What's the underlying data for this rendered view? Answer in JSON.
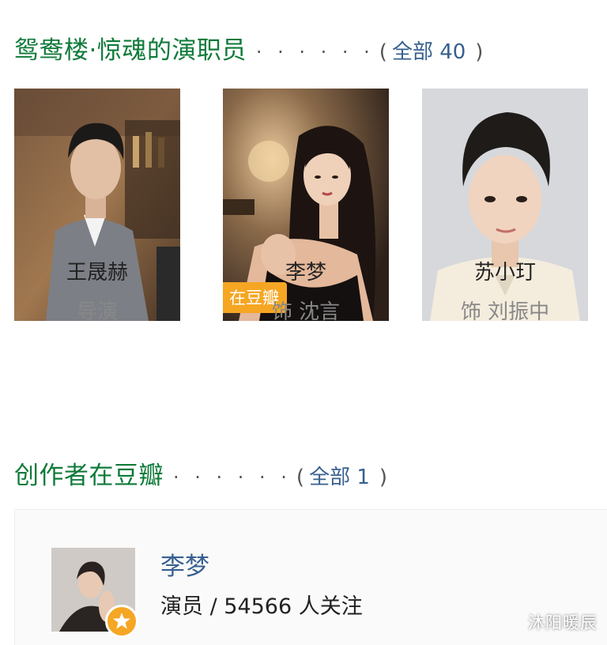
{
  "cast_section": {
    "title": "鸳鸯楼·惊魂的演职员",
    "dots": "· · · · · ·",
    "open_paren": "(",
    "all_label": "全部 40",
    "close_paren": ")"
  },
  "cast": [
    {
      "name": "王晟赫",
      "role": "导演"
    },
    {
      "name": "李梦",
      "role": "饰 沈言",
      "badge": "在豆瓣"
    },
    {
      "name": "苏小玎",
      "role": "饰 刘振中"
    }
  ],
  "creators_section": {
    "title": "创作者在豆瓣",
    "dots": "· · · · · ·",
    "open_paren": "(",
    "all_label": "全部 1",
    "close_paren": ")"
  },
  "creator": {
    "name": "李梦",
    "info": "演员 / 54566 人关注"
  },
  "watermark": "沐阳暖辰",
  "colors": {
    "section_title": "#0f7a3a",
    "link": "#37608f",
    "badge": "#f5a623"
  }
}
